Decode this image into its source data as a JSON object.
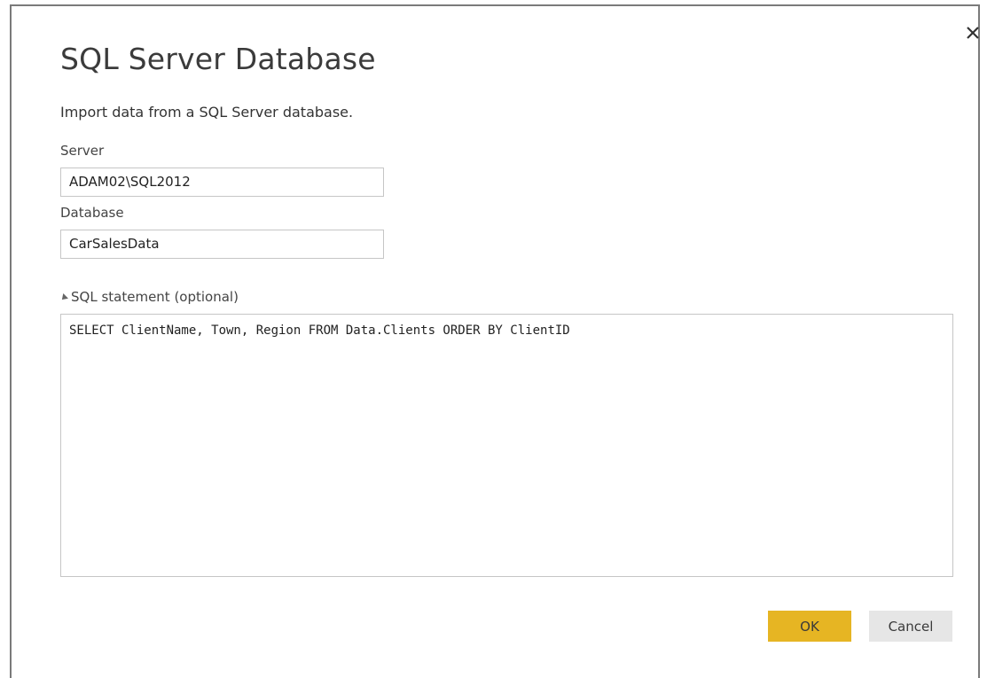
{
  "dialog": {
    "title": "SQL Server Database",
    "subtitle": "Import data from a SQL Server database.",
    "close_icon": "close-icon"
  },
  "server": {
    "label": "Server",
    "value": "ADAM02\\SQL2012"
  },
  "database": {
    "label": "Database",
    "value": "CarSalesData"
  },
  "sql": {
    "toggle_icon": "expanded-triangle-icon",
    "label": "SQL statement (optional)",
    "value": "SELECT ClientName, Town, Region FROM Data.Clients ORDER BY ClientID"
  },
  "buttons": {
    "ok_label": "OK",
    "cancel_label": "Cancel",
    "ok_color": "#e6b523",
    "cancel_color": "#e6e6e6"
  }
}
